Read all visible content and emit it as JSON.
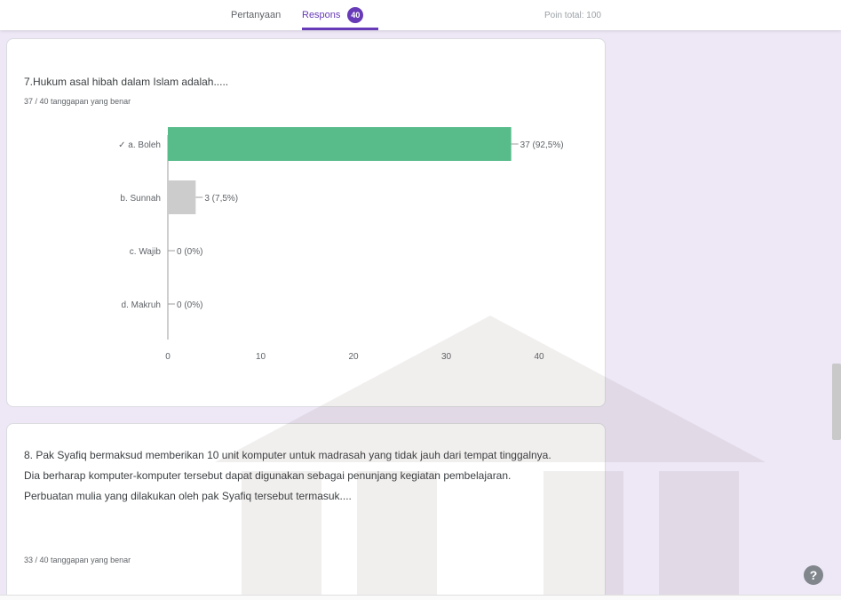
{
  "header": {
    "tabs": [
      {
        "label": "Pertanyaan"
      },
      {
        "label": "Respons",
        "count": "40"
      }
    ],
    "total_points": "Poin total: 100"
  },
  "question7": {
    "title": "7.Hukum asal hibah dalam Islam adalah.....",
    "summary": "37 / 40 tanggapan yang benar"
  },
  "question8": {
    "title": "8. Pak Syafiq bermaksud memberikan 10 unit komputer untuk madrasah yang tidak jauh dari tempat tinggalnya. Dia berharap komputer-komputer tersebut dapat digunakan sebagai penunjang kegiatan pembelajaran. Perbuatan mulia yang dilakukan oleh pak Syafiq tersebut termasuk....",
    "summary": "33 / 40 tanggapan yang benar"
  },
  "chart_data": {
    "type": "bar",
    "orientation": "horizontal",
    "categories": [
      "✓ a. Boleh",
      "b. Sunnah",
      "c. Wajib",
      "d. Makruh"
    ],
    "values": [
      37,
      3,
      0,
      0
    ],
    "value_labels": [
      "37 (92,5%)",
      "3 (7,5%)",
      "0 (0%)",
      "0 (0%)"
    ],
    "correct_index": 0,
    "xlim": [
      0,
      40
    ],
    "xticks": [
      0,
      10,
      20,
      30,
      40
    ],
    "colors": {
      "correct": "#57bb8a",
      "other": "#cccccc"
    }
  },
  "colors": {
    "accent": "#673ab7"
  },
  "icons": {
    "help": "help-icon"
  }
}
